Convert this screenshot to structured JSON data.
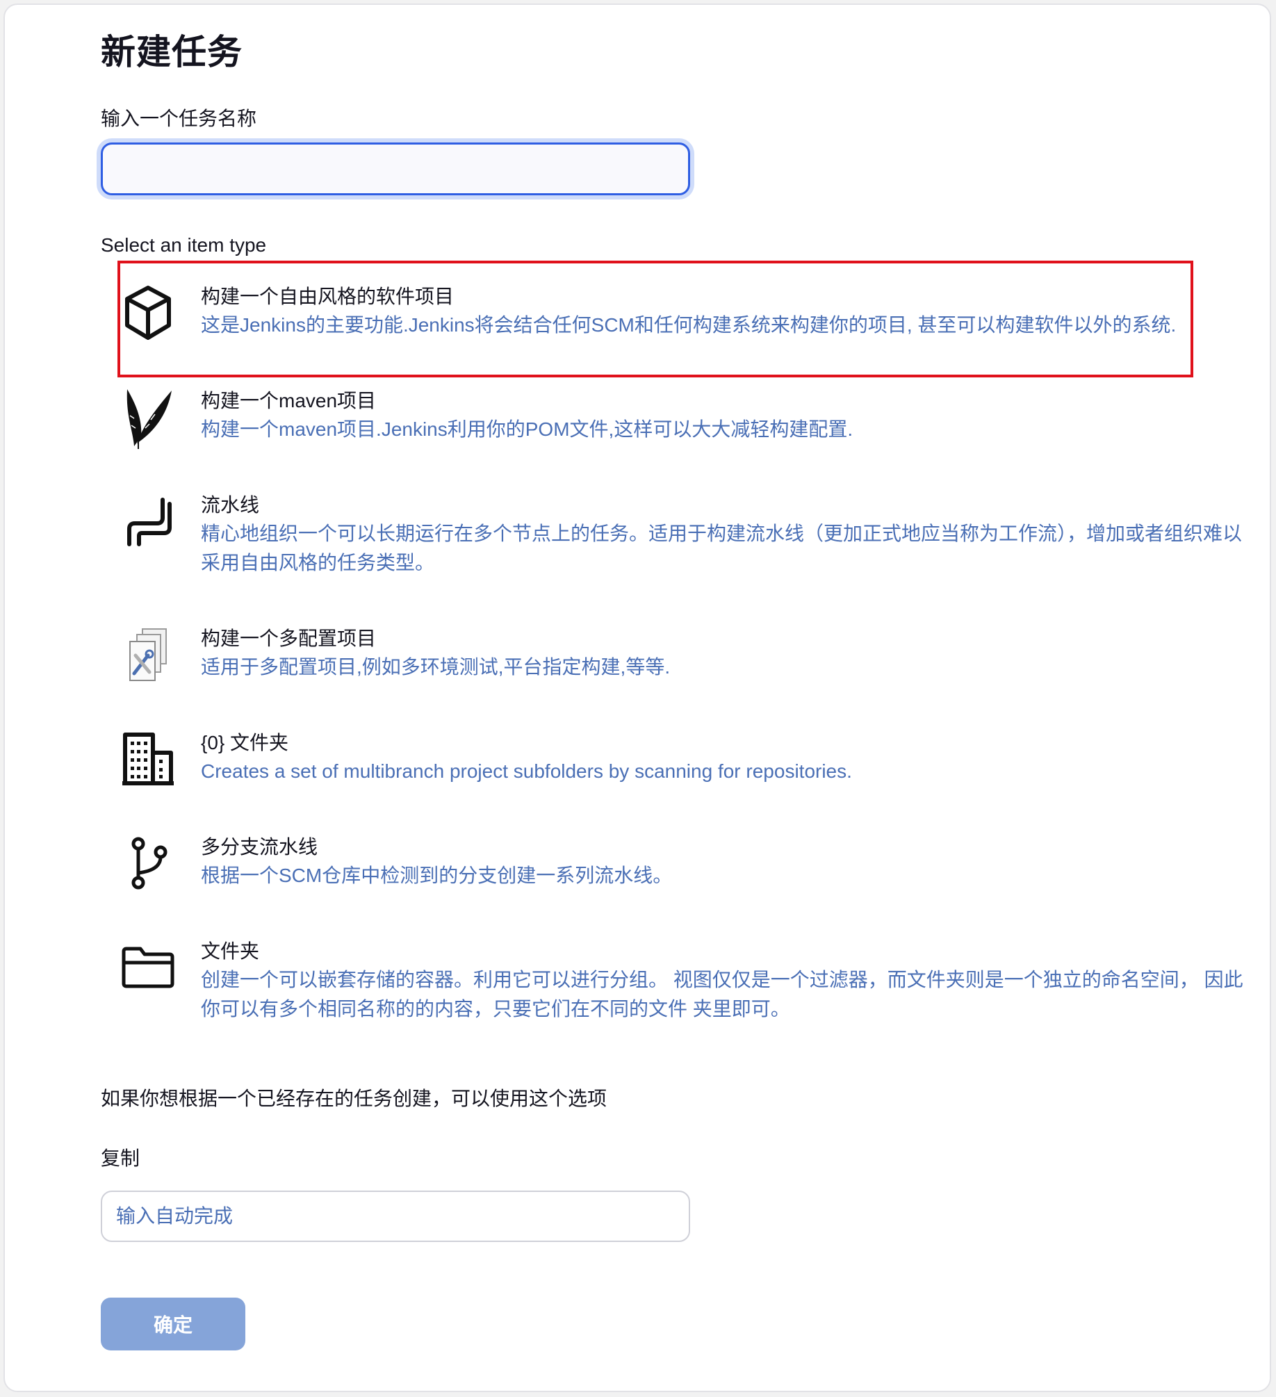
{
  "page": {
    "title": "新建任务"
  },
  "name_field": {
    "label": "输入一个任务名称",
    "value": "",
    "placeholder": ""
  },
  "item_type": {
    "label": "Select an item type",
    "items": [
      {
        "icon": "package-box-icon",
        "title": "构建一个自由风格的软件项目",
        "description": "这是Jenkins的主要功能.Jenkins将会结合任何SCM和任何构建系统来构建你的项目, 甚至可以构建软件以外的系统.",
        "highlighted": true
      },
      {
        "icon": "maven-feather-icon",
        "title": "构建一个maven项目",
        "description": "构建一个maven项目.Jenkins利用你的POM文件,这样可以大大减轻构建配置."
      },
      {
        "icon": "pipeline-icon",
        "title": "流水线",
        "description": "精心地组织一个可以长期运行在多个节点上的任务。适用于构建流水线（更加正式地应当称为工作流），增加或者组织难以采用自由风格的任务类型。"
      },
      {
        "icon": "multi-config-icon",
        "title": "构建一个多配置项目",
        "description": "适用于多配置项目,例如多环境测试,平台指定构建,等等."
      },
      {
        "icon": "organization-building-icon",
        "title": "{0} 文件夹",
        "description": "Creates a set of multibranch project subfolders by scanning for repositories."
      },
      {
        "icon": "branch-icon",
        "title": "多分支流水线",
        "description": "根据一个SCM仓库中检测到的分支创建一系列流水线。"
      },
      {
        "icon": "folder-icon",
        "title": "文件夹",
        "description": "创建一个可以嵌套存储的容器。利用它可以进行分组。 视图仅仅是一个过滤器，而文件夹则是一个独立的命名空间， 因此你可以有多个相同名称的的内容，只要它们在不同的文件 夹里即可。"
      }
    ]
  },
  "copy": {
    "hint": "如果你想根据一个已经存在的任务创建，可以使用这个选项",
    "label": "复制",
    "placeholder": "输入自动完成",
    "value": ""
  },
  "submit": {
    "label": "确定"
  },
  "colors": {
    "accent_border": "#2f5ee3",
    "description_text": "#4a6fb5",
    "highlight_border": "#e0111b",
    "button_bg": "#85a4d9"
  }
}
